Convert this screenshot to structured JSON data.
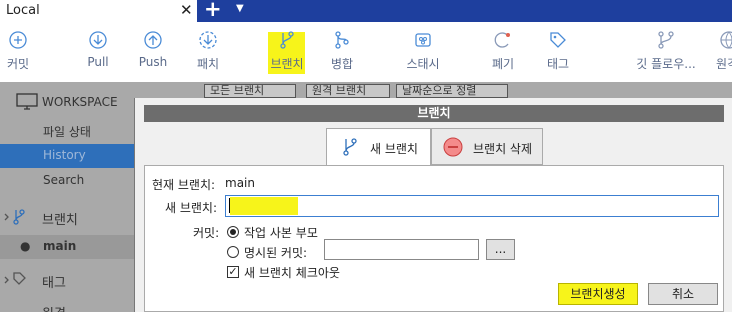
{
  "tabbar": {
    "title": "Local",
    "close": "✕",
    "add": "+",
    "menu": "▼"
  },
  "toolbar": {
    "commit": "커밋",
    "pull": "Pull",
    "push": "Push",
    "fetch": "패치",
    "branch": "브랜치",
    "merge": "병합",
    "stash": "스태시",
    "discard": "폐기",
    "tag": "태그",
    "gitflow": "깃 플로우...",
    "remote": "원격"
  },
  "sidebar": {
    "workspace": "WORKSPACE",
    "file_status": "파일 상태",
    "history": "History",
    "search": "Search",
    "branches": "브랜치",
    "main": "main",
    "tags": "태그",
    "remotes": "원격"
  },
  "filters": {
    "all_branches": "모든 브랜치",
    "remote_branches": "원격 브랜치",
    "sort": "날짜순으로 정렬"
  },
  "dialog": {
    "title": "브랜치",
    "tab_new": "새 브랜치",
    "tab_delete": "브랜치 삭제",
    "current_branch_label": "현재 브랜치:",
    "current_branch_value": "main",
    "new_branch_label": "새 브랜치:",
    "new_branch_value": "",
    "commit_label": "커밋:",
    "radio_working_copy": "작업 사본 부모",
    "radio_specified": "명시된 커밋:",
    "specified_value": "",
    "browse": "...",
    "checkout_label": "새 브랜치 체크아웃",
    "create_button": "브랜치생성",
    "cancel_button": "취소"
  },
  "colors": {
    "accent": "#1e3f9e",
    "highlight": "#f7f41a",
    "selection": "#2e6fba"
  }
}
